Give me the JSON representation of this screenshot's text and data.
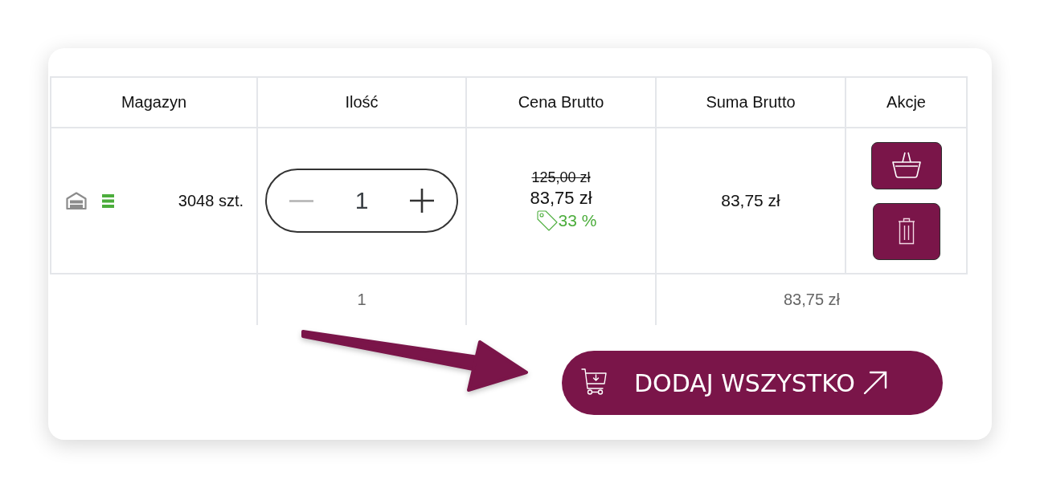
{
  "table": {
    "columns": [
      "Magazyn",
      "Ilość",
      "Cena Brutto",
      "Suma Brutto",
      "Akcje"
    ],
    "rows": [
      {
        "stock": "3048 szt.",
        "quantity": "1",
        "decrement_disabled": true,
        "old_price": "125,00 zł",
        "price": "83,75 zł",
        "discount": "33 %",
        "total": "83,75 zł",
        "actions": [
          {
            "kind": "basket"
          },
          {
            "kind": "trash"
          }
        ]
      }
    ],
    "footer": {
      "quantity": "1",
      "total": "83,75 zł"
    }
  },
  "add_all_button": {
    "label": "DODAJ WSZYSTKO"
  }
}
